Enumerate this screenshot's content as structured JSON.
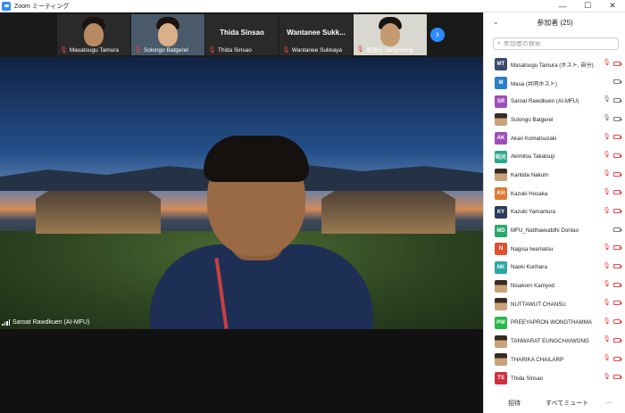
{
  "window": {
    "title": "Zoom ミーティング",
    "controls": [
      "—",
      "☐",
      "✕"
    ]
  },
  "gallery": [
    {
      "name": "Masatsugu Tamura",
      "muted": true,
      "type": "video"
    },
    {
      "name": "Solongo Batgerel",
      "muted": true,
      "type": "video"
    },
    {
      "name": "Thida Sinsao",
      "muted": true,
      "type": "name",
      "display": "Thida Sinsao"
    },
    {
      "name": "Wantanee Sukkaya",
      "muted": true,
      "type": "name",
      "display": "Wantanee  Sukk..."
    },
    {
      "name": "梁雅仕 liangcheng",
      "muted": true,
      "type": "video"
    }
  ],
  "next_icon": "chevron-right-icon",
  "speaker": {
    "name": "Saroat Rawdkuen (AI-MFU)"
  },
  "panel": {
    "title": "参加者 (25)",
    "search_placeholder": "参加者の検索",
    "participants": [
      {
        "initials": "MT",
        "color": "#3a4a6a",
        "name": "Masatsugu Tamura (ホスト, 自分)",
        "mic": "off",
        "cam": "off"
      },
      {
        "initials": "M",
        "color": "#2a7fc9",
        "name": "Masa (共同ホスト)",
        "mic": "none",
        "cam": "on"
      },
      {
        "initials": "SR",
        "color": "#9c4fb8",
        "name": "Saroat Rawdkuen (AI-MFU)",
        "mic": "on",
        "cam": "on"
      },
      {
        "initials": "",
        "color": "",
        "photo": true,
        "name": "Solongo Batgerel",
        "mic": "on",
        "cam": "on"
      },
      {
        "initials": "AK",
        "color": "#9c4fb8",
        "name": "Akari Komatsuzaki",
        "mic": "off",
        "cam": "off"
      },
      {
        "initials": "昭光",
        "color": "#2aa88a",
        "name": "Akimitsu Takatsuji",
        "mic": "off",
        "cam": "off"
      },
      {
        "initials": "",
        "color": "",
        "photo": true,
        "name": "Kantida Nakum",
        "mic": "off",
        "cam": "off"
      },
      {
        "initials": "KH",
        "color": "#e07a30",
        "name": "Kazuki Hosaka",
        "mic": "off",
        "cam": "off"
      },
      {
        "initials": "KY",
        "color": "#2a3a5a",
        "name": "Kazuki Yamamura",
        "mic": "off",
        "cam": "off"
      },
      {
        "initials": "MD",
        "color": "#2aa86a",
        "name": "MFU_Natthawuddhi Donlao",
        "mic": "none",
        "cam": "on"
      },
      {
        "initials": "N",
        "color": "#e05030",
        "name": "Nagisa   Iwamatsu",
        "mic": "off",
        "cam": "off"
      },
      {
        "initials": "NK",
        "color": "#2aa8a8",
        "name": "Naoki Kurihara",
        "mic": "off",
        "cam": "off"
      },
      {
        "initials": "",
        "color": "",
        "photo": true,
        "name": "Nisakorn Kamyod",
        "mic": "off",
        "cam": "off"
      },
      {
        "initials": "",
        "color": "",
        "photo": true,
        "name": "NUTTAWUT CHANSU",
        "mic": "off",
        "cam": "off"
      },
      {
        "initials": "PW",
        "color": "#2ab84a",
        "name": "PREEYAPRON WONGTHAMMA",
        "mic": "off",
        "cam": "off"
      },
      {
        "initials": "",
        "color": "",
        "photo": true,
        "name": "TANWARAT EUNGCHAIWONG",
        "mic": "off",
        "cam": "off"
      },
      {
        "initials": "",
        "color": "",
        "photo": true,
        "name": "THARIKA CHAILARP",
        "mic": "off",
        "cam": "off"
      },
      {
        "initials": "TS",
        "color": "#d03040",
        "name": "Thida Sinsao",
        "mic": "off",
        "cam": "off"
      }
    ],
    "footer": {
      "invite": "招待",
      "mute_all": "すべてミュート",
      "more": "..."
    }
  }
}
